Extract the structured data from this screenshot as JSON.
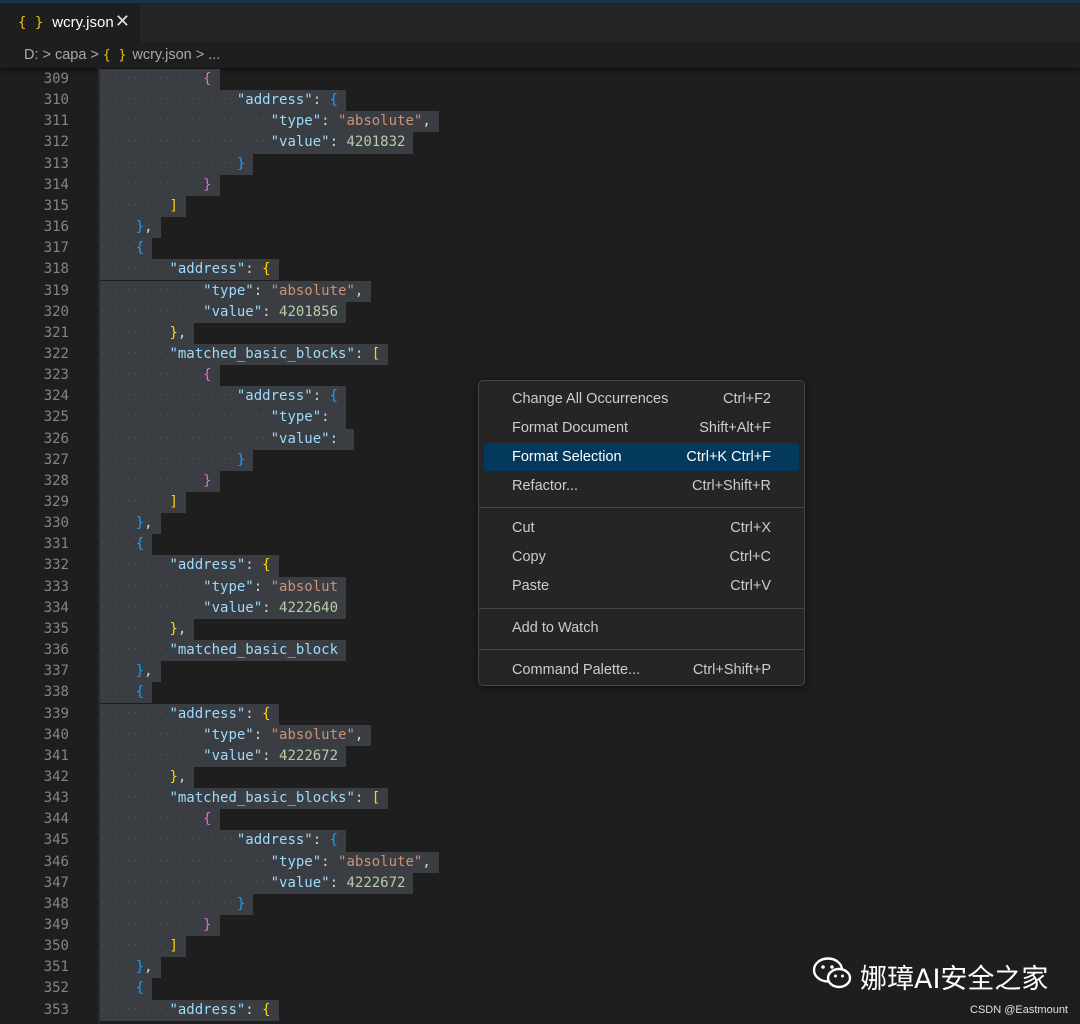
{
  "tab": {
    "icon": "json-braces-icon",
    "title": "wcry.json",
    "close_symbol": "✕"
  },
  "breadcrumb": {
    "drive": "D:",
    "folder": "capa",
    "file": "wcry.json",
    "rest": "..."
  },
  "lines": [
    {
      "n": "309",
      "indent": 12,
      "tokens": [
        [
          "b2",
          "{"
        ]
      ]
    },
    {
      "n": "310",
      "indent": 16,
      "tokens": [
        [
          "tk-key",
          "\"address\""
        ],
        [
          "tk-p",
          ": "
        ],
        [
          "b3",
          "{"
        ]
      ]
    },
    {
      "n": "311",
      "indent": 20,
      "tokens": [
        [
          "tk-key",
          "\"type\""
        ],
        [
          "tk-p",
          ": "
        ],
        [
          "tk-str",
          "\"absolute\""
        ],
        [
          "tk-p",
          ","
        ]
      ]
    },
    {
      "n": "312",
      "indent": 20,
      "tokens": [
        [
          "tk-key",
          "\"value\""
        ],
        [
          "tk-p",
          ": "
        ],
        [
          "tk-num",
          "4201832"
        ]
      ]
    },
    {
      "n": "313",
      "indent": 16,
      "tokens": [
        [
          "b3",
          "}"
        ]
      ]
    },
    {
      "n": "314",
      "indent": 12,
      "tokens": [
        [
          "b2",
          "}"
        ]
      ]
    },
    {
      "n": "315",
      "indent": 8,
      "tokens": [
        [
          "b1",
          "]"
        ]
      ]
    },
    {
      "n": "316",
      "indent": 4,
      "tokens": [
        [
          "b3",
          "}"
        ],
        [
          "tk-p",
          ","
        ]
      ]
    },
    {
      "n": "317",
      "indent": 4,
      "tokens": [
        [
          "b3",
          "{"
        ]
      ]
    },
    {
      "n": "318",
      "indent": 8,
      "tokens": [
        [
          "tk-key",
          "\"address\""
        ],
        [
          "tk-p",
          ": "
        ],
        [
          "b1",
          "{"
        ]
      ]
    },
    {
      "n": "319",
      "indent": 12,
      "tokens": [
        [
          "tk-key",
          "\"type\""
        ],
        [
          "tk-p",
          ": "
        ],
        [
          "tk-str",
          "\"absolute\""
        ],
        [
          "tk-p",
          ","
        ]
      ]
    },
    {
      "n": "320",
      "indent": 12,
      "tokens": [
        [
          "tk-key",
          "\"value\""
        ],
        [
          "tk-p",
          ": "
        ],
        [
          "tk-num",
          "4201856"
        ]
      ]
    },
    {
      "n": "321",
      "indent": 8,
      "tokens": [
        [
          "b1",
          "}"
        ],
        [
          "tk-p",
          ","
        ]
      ]
    },
    {
      "n": "322",
      "indent": 8,
      "tokens": [
        [
          "tk-key",
          "\"matched_basic_blocks\""
        ],
        [
          "tk-p",
          ": "
        ],
        [
          "b1",
          "["
        ]
      ]
    },
    {
      "n": "323",
      "indent": 12,
      "tokens": [
        [
          "b2",
          "{"
        ]
      ]
    },
    {
      "n": "324",
      "indent": 16,
      "tokens": [
        [
          "tk-key",
          "\"address\""
        ],
        [
          "tk-p",
          ": "
        ],
        [
          "b3",
          "{"
        ]
      ]
    },
    {
      "n": "325",
      "indent": 20,
      "tokens": [
        [
          "tk-key",
          "\"type\""
        ],
        [
          "tk-p",
          ": "
        ]
      ]
    },
    {
      "n": "326",
      "indent": 20,
      "tokens": [
        [
          "tk-key",
          "\"value\""
        ],
        [
          "tk-p",
          ": "
        ]
      ]
    },
    {
      "n": "327",
      "indent": 16,
      "tokens": [
        [
          "b3",
          "}"
        ]
      ]
    },
    {
      "n": "328",
      "indent": 12,
      "tokens": [
        [
          "b2",
          "}"
        ]
      ]
    },
    {
      "n": "329",
      "indent": 8,
      "tokens": [
        [
          "b1",
          "]"
        ]
      ]
    },
    {
      "n": "330",
      "indent": 4,
      "tokens": [
        [
          "b3",
          "}"
        ],
        [
          "tk-p",
          ","
        ]
      ]
    },
    {
      "n": "331",
      "indent": 4,
      "tokens": [
        [
          "b3",
          "{"
        ]
      ]
    },
    {
      "n": "332",
      "indent": 8,
      "tokens": [
        [
          "tk-key",
          "\"address\""
        ],
        [
          "tk-p",
          ": "
        ],
        [
          "b1",
          "{"
        ]
      ]
    },
    {
      "n": "333",
      "indent": 12,
      "tokens": [
        [
          "tk-key",
          "\"type\""
        ],
        [
          "tk-p",
          ": "
        ],
        [
          "tk-str",
          "\"absolut"
        ]
      ]
    },
    {
      "n": "334",
      "indent": 12,
      "tokens": [
        [
          "tk-key",
          "\"value\""
        ],
        [
          "tk-p",
          ": "
        ],
        [
          "tk-num",
          "4222640"
        ]
      ]
    },
    {
      "n": "335",
      "indent": 8,
      "tokens": [
        [
          "b1",
          "}"
        ],
        [
          "tk-p",
          ","
        ]
      ]
    },
    {
      "n": "336",
      "indent": 8,
      "tokens": [
        [
          "tk-key",
          "\"matched_basic_block"
        ]
      ]
    },
    {
      "n": "337",
      "indent": 4,
      "tokens": [
        [
          "b3",
          "}"
        ],
        [
          "tk-p",
          ","
        ]
      ]
    },
    {
      "n": "338",
      "indent": 4,
      "tokens": [
        [
          "b3",
          "{"
        ]
      ]
    },
    {
      "n": "339",
      "indent": 8,
      "tokens": [
        [
          "tk-key",
          "\"address\""
        ],
        [
          "tk-p",
          ": "
        ],
        [
          "b1",
          "{"
        ]
      ]
    },
    {
      "n": "340",
      "indent": 12,
      "tokens": [
        [
          "tk-key",
          "\"type\""
        ],
        [
          "tk-p",
          ": "
        ],
        [
          "tk-str",
          "\"absolute\""
        ],
        [
          "tk-p",
          ","
        ]
      ]
    },
    {
      "n": "341",
      "indent": 12,
      "tokens": [
        [
          "tk-key",
          "\"value\""
        ],
        [
          "tk-p",
          ": "
        ],
        [
          "tk-num",
          "4222672"
        ]
      ]
    },
    {
      "n": "342",
      "indent": 8,
      "tokens": [
        [
          "b1",
          "}"
        ],
        [
          "tk-p",
          ","
        ]
      ]
    },
    {
      "n": "343",
      "indent": 8,
      "tokens": [
        [
          "tk-key",
          "\"matched_basic_blocks\""
        ],
        [
          "tk-p",
          ": "
        ],
        [
          "b1",
          "["
        ]
      ]
    },
    {
      "n": "344",
      "indent": 12,
      "tokens": [
        [
          "b2",
          "{"
        ]
      ]
    },
    {
      "n": "345",
      "indent": 16,
      "tokens": [
        [
          "tk-key",
          "\"address\""
        ],
        [
          "tk-p",
          ": "
        ],
        [
          "b3",
          "{"
        ]
      ]
    },
    {
      "n": "346",
      "indent": 20,
      "tokens": [
        [
          "tk-key",
          "\"type\""
        ],
        [
          "tk-p",
          ": "
        ],
        [
          "tk-str",
          "\"absolute\""
        ],
        [
          "tk-p",
          ","
        ]
      ]
    },
    {
      "n": "347",
      "indent": 20,
      "tokens": [
        [
          "tk-key",
          "\"value\""
        ],
        [
          "tk-p",
          ": "
        ],
        [
          "tk-num",
          "4222672"
        ]
      ]
    },
    {
      "n": "348",
      "indent": 16,
      "tokens": [
        [
          "b3",
          "}"
        ]
      ]
    },
    {
      "n": "349",
      "indent": 12,
      "tokens": [
        [
          "b2",
          "}"
        ]
      ]
    },
    {
      "n": "350",
      "indent": 8,
      "tokens": [
        [
          "b1",
          "]"
        ]
      ]
    },
    {
      "n": "351",
      "indent": 4,
      "tokens": [
        [
          "b3",
          "}"
        ],
        [
          "tk-p",
          ","
        ]
      ]
    },
    {
      "n": "352",
      "indent": 4,
      "tokens": [
        [
          "b3",
          "{"
        ]
      ]
    },
    {
      "n": "353",
      "indent": 8,
      "tokens": [
        [
          "tk-key",
          "\"address\""
        ],
        [
          "tk-p",
          ": "
        ],
        [
          "b1",
          "{"
        ]
      ]
    }
  ],
  "context_menu": {
    "groups": [
      [
        {
          "label": "Change All Occurrences",
          "shortcut": "Ctrl+F2"
        },
        {
          "label": "Format Document",
          "shortcut": "Shift+Alt+F"
        },
        {
          "label": "Format Selection",
          "shortcut": "Ctrl+K Ctrl+F",
          "active": true
        },
        {
          "label": "Refactor...",
          "shortcut": "Ctrl+Shift+R"
        }
      ],
      [
        {
          "label": "Cut",
          "shortcut": "Ctrl+X"
        },
        {
          "label": "Copy",
          "shortcut": "Ctrl+C"
        },
        {
          "label": "Paste",
          "shortcut": "Ctrl+V"
        }
      ],
      [
        {
          "label": "Add to Watch",
          "shortcut": ""
        }
      ],
      [
        {
          "label": "Command Palette...",
          "shortcut": "Ctrl+Shift+P"
        }
      ]
    ]
  },
  "watermark": {
    "icon": "wechat-icon",
    "text": "娜璋AI安全之家",
    "csdn": "CSDN @Eastmount"
  },
  "colors": {
    "accent": "#04395e",
    "key": "#9cdcfe",
    "string": "#ce9178",
    "number": "#b5cea8"
  }
}
